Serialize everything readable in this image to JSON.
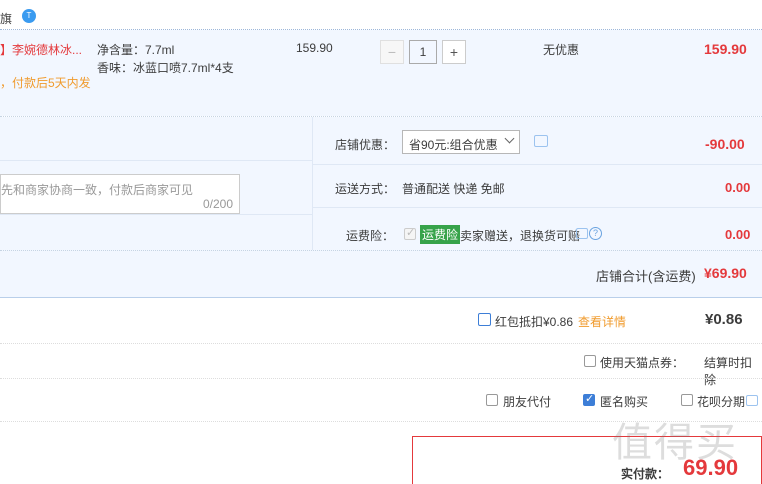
{
  "shop": {
    "name": "旗",
    "badge": "T"
  },
  "item": {
    "title": "】李婉德林冰...",
    "delivery_note": "，付款后5天内发",
    "spec_volume": "净含量：7.7ml",
    "spec_flavor": "香味：冰蓝口喷7.7ml*4支",
    "unit_price": "159.90",
    "quantity": "1",
    "minus": "−",
    "plus": "+",
    "promo": "无优惠",
    "subtotal": "159.90"
  },
  "message": {
    "placeholder": "先和商家协商一致，付款后商家可见",
    "counter": "0/200"
  },
  "shop_discount": {
    "label": "店铺优惠：",
    "selected": "省90元:组合优惠",
    "amount": "-90.00"
  },
  "shipping": {
    "label": "运送方式：",
    "method": "普通配送 快递 免邮",
    "amount": "0.00"
  },
  "insurance": {
    "label": "运费险：",
    "tag": "运费险",
    "text": "卖家赠送，退换货可赔",
    "amount": "0.00"
  },
  "shop_total": {
    "label": "店铺合计(含运费)",
    "amount": "¥69.90"
  },
  "redpacket": {
    "label": "红包抵扣¥0.86",
    "link": "查看详情",
    "amount": "¥0.86"
  },
  "tmall_points": {
    "label": "使用天猫点券：",
    "note": "结算时扣除"
  },
  "options": {
    "friend_pay": "朋友代付",
    "anonymous": "匿名购买",
    "huabei": "花呗分期"
  },
  "pay": {
    "label": "实付款：",
    "amount": "69.90"
  },
  "watermark": "值得买"
}
